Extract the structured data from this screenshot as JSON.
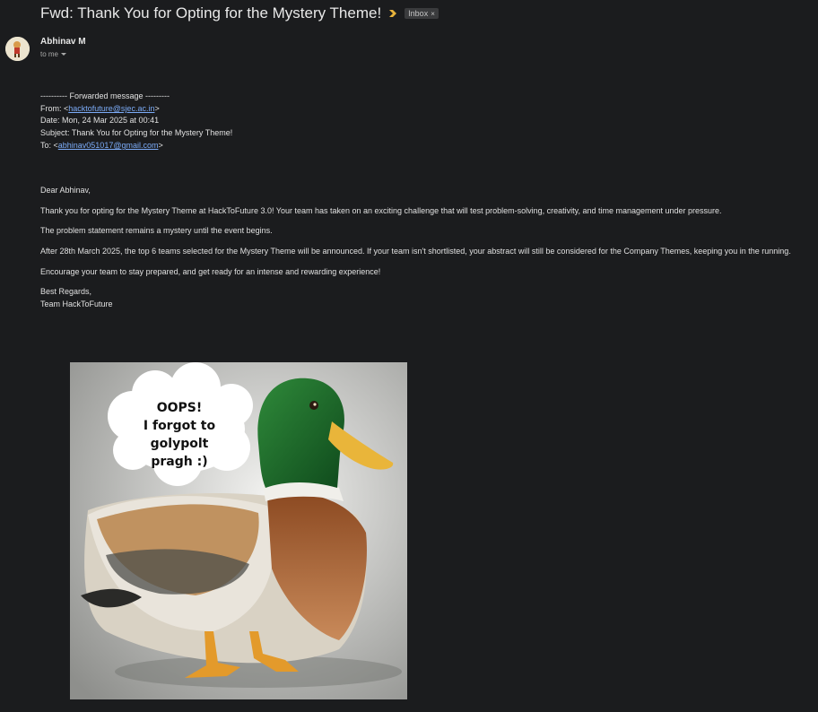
{
  "header": {
    "subject": "Fwd: Thank You for Opting for the Mystery Theme!",
    "label": "Inbox",
    "label_close": "×"
  },
  "sender": {
    "name": "Abhinav M",
    "recipient": "to me"
  },
  "forwarded": {
    "separator": "---------- Forwarded message ---------",
    "from_prefix": "From: <",
    "from_email": "hacktofuture@sjec.ac.in",
    "from_suffix": ">",
    "date": "Date: Mon, 24 Mar 2025 at 00:41",
    "subject": "Subject: Thank You for Opting for the Mystery Theme!",
    "to_prefix": "To: <",
    "to_email": "abhinav051017@gmail.com",
    "to_suffix": ">"
  },
  "message": {
    "greeting": "Dear Abhinav,",
    "para1": "Thank you for opting for the Mystery Theme at HackToFuture 3.0! Your team has taken on an exciting challenge that will test problem-solving, creativity, and time management under pressure.",
    "para2": "The problem statement remains a mystery until the event begins.",
    "para3": "After 28th March 2025, the top 6 teams selected for the Mystery Theme will be announced. If your team isn't shortlisted, your abstract will still be considered for the Company Themes, keeping you in the running.",
    "para4": "Encourage your team to stay prepared, and get ready for an intense and rewarding experience!",
    "signoff1": "Best Regards,",
    "signoff2": "Team HackToFuture"
  },
  "image": {
    "bubble_line1": "OOPS!",
    "bubble_line2": "I forgot to golypolt",
    "bubble_line3": "pragh :)"
  },
  "colors": {
    "background": "#1b1c1e",
    "link": "#7cacf8",
    "importance_marker": "#e8b33b"
  }
}
